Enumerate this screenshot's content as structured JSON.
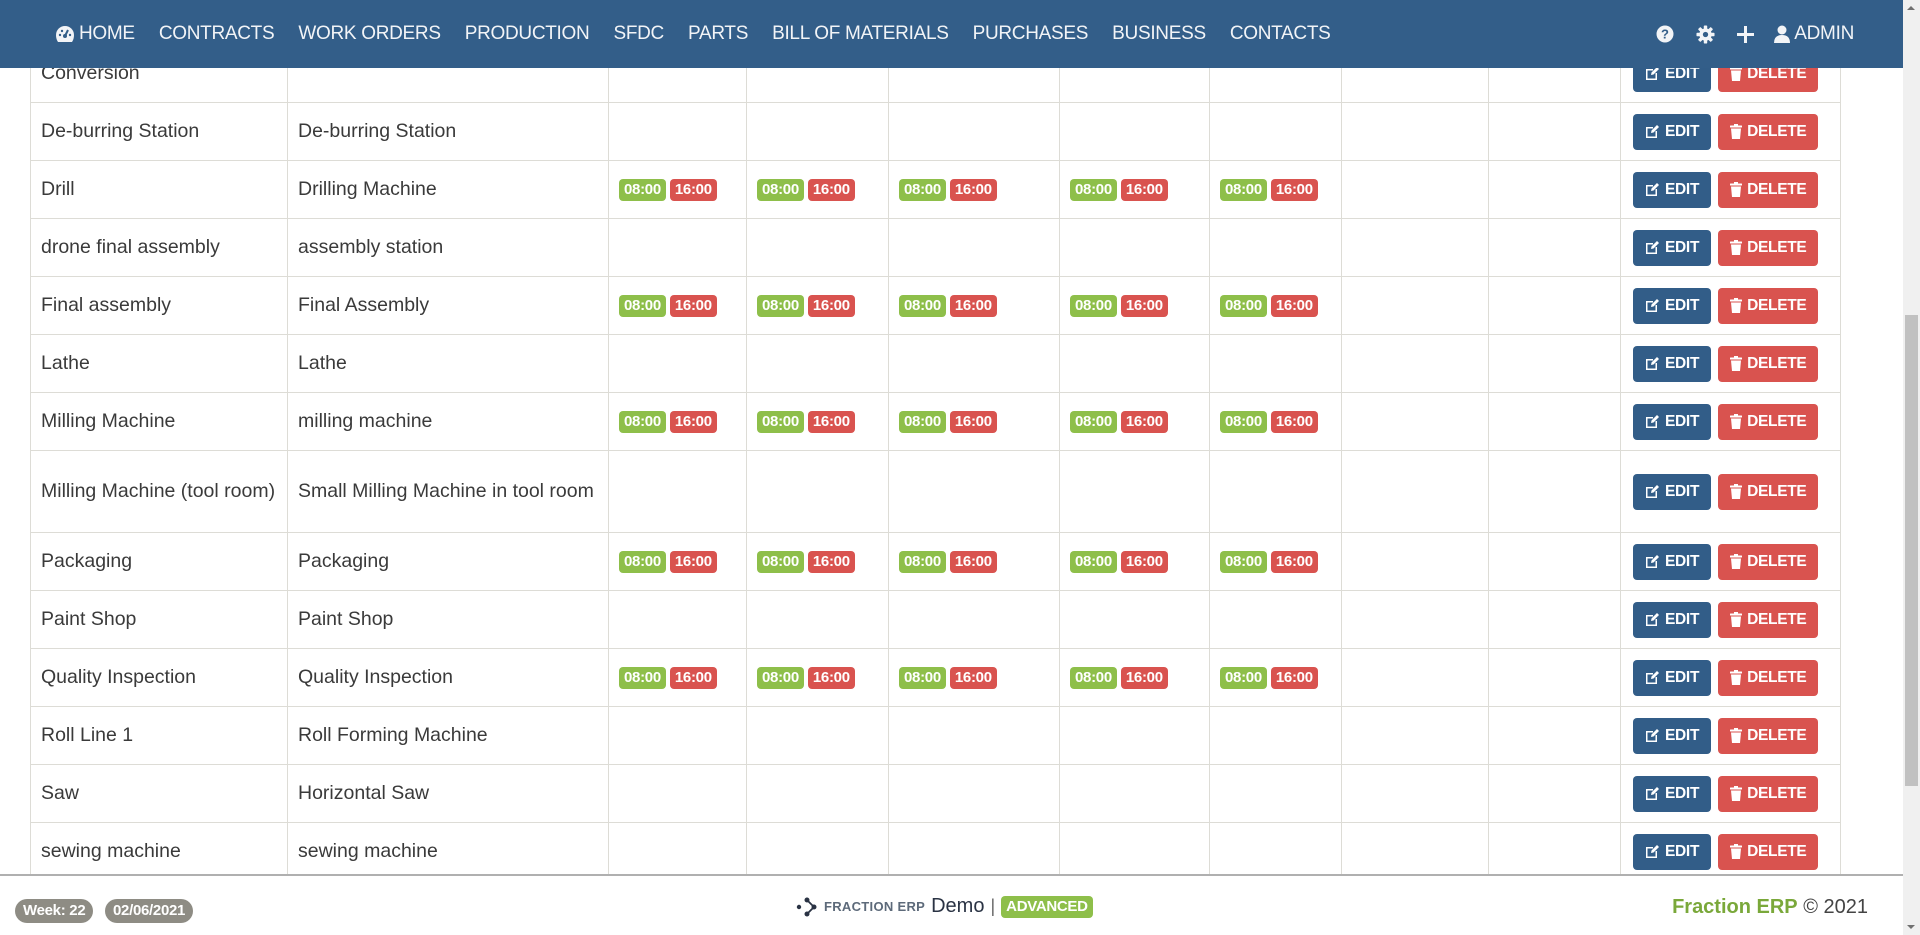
{
  "nav": {
    "items": [
      {
        "label": "HOME",
        "icon": "dashboard-icon"
      },
      {
        "label": "CONTRACTS"
      },
      {
        "label": "WORK ORDERS"
      },
      {
        "label": "PRODUCTION"
      },
      {
        "label": "SFDC"
      },
      {
        "label": "PARTS"
      },
      {
        "label": "BILL OF MATERIALS"
      },
      {
        "label": "PURCHASES"
      },
      {
        "label": "BUSINESS"
      },
      {
        "label": "CONTACTS"
      }
    ],
    "right": {
      "help_icon": "question-circle-icon",
      "settings_icon": "gear-icon",
      "add_icon": "plus-icon",
      "user_label": "ADMIN",
      "user_icon": "user-icon"
    }
  },
  "table": {
    "edit_label": "EDIT",
    "delete_label": "DELETE",
    "rows": [
      {
        "name": "Conversion",
        "description": "",
        "schedule": [
          null,
          null,
          null,
          null,
          null,
          null,
          null
        ]
      },
      {
        "name": "De-burring Station",
        "description": "De-burring Station",
        "schedule": [
          null,
          null,
          null,
          null,
          null,
          null,
          null
        ]
      },
      {
        "name": "Drill",
        "description": "Drilling Machine",
        "schedule": [
          [
            "08:00",
            "16:00"
          ],
          [
            "08:00",
            "16:00"
          ],
          [
            "08:00",
            "16:00"
          ],
          [
            "08:00",
            "16:00"
          ],
          [
            "08:00",
            "16:00"
          ],
          null,
          null
        ]
      },
      {
        "name": "drone final assembly",
        "description": "assembly station",
        "schedule": [
          null,
          null,
          null,
          null,
          null,
          null,
          null
        ]
      },
      {
        "name": "Final assembly",
        "description": "Final Assembly",
        "schedule": [
          [
            "08:00",
            "16:00"
          ],
          [
            "08:00",
            "16:00"
          ],
          [
            "08:00",
            "16:00"
          ],
          [
            "08:00",
            "16:00"
          ],
          [
            "08:00",
            "16:00"
          ],
          null,
          null
        ]
      },
      {
        "name": "Lathe",
        "description": "Lathe",
        "schedule": [
          null,
          null,
          null,
          null,
          null,
          null,
          null
        ]
      },
      {
        "name": "Milling Machine",
        "description": "milling machine",
        "schedule": [
          [
            "08:00",
            "16:00"
          ],
          [
            "08:00",
            "16:00"
          ],
          [
            "08:00",
            "16:00"
          ],
          [
            "08:00",
            "16:00"
          ],
          [
            "08:00",
            "16:00"
          ],
          null,
          null
        ]
      },
      {
        "name": "Milling Machine (tool room)",
        "description": "Small Milling Machine in tool room",
        "schedule": [
          null,
          null,
          null,
          null,
          null,
          null,
          null
        ]
      },
      {
        "name": "Packaging",
        "description": "Packaging",
        "schedule": [
          [
            "08:00",
            "16:00"
          ],
          [
            "08:00",
            "16:00"
          ],
          [
            "08:00",
            "16:00"
          ],
          [
            "08:00",
            "16:00"
          ],
          [
            "08:00",
            "16:00"
          ],
          null,
          null
        ]
      },
      {
        "name": "Paint Shop",
        "description": "Paint Shop",
        "schedule": [
          null,
          null,
          null,
          null,
          null,
          null,
          null
        ]
      },
      {
        "name": "Quality Inspection",
        "description": "Quality Inspection",
        "schedule": [
          [
            "08:00",
            "16:00"
          ],
          [
            "08:00",
            "16:00"
          ],
          [
            "08:00",
            "16:00"
          ],
          [
            "08:00",
            "16:00"
          ],
          [
            "08:00",
            "16:00"
          ],
          null,
          null
        ]
      },
      {
        "name": "Roll Line 1",
        "description": "Roll Forming Machine",
        "schedule": [
          null,
          null,
          null,
          null,
          null,
          null,
          null
        ]
      },
      {
        "name": "Saw",
        "description": "Horizontal Saw",
        "schedule": [
          null,
          null,
          null,
          null,
          null,
          null,
          null
        ]
      },
      {
        "name": "sewing machine",
        "description": "sewing machine",
        "schedule": [
          null,
          null,
          null,
          null,
          null,
          null,
          null
        ]
      }
    ]
  },
  "footer": {
    "week_label": "Week: 22",
    "date_label": "02/06/2021",
    "brand_name": "FRACTION ERP",
    "brand_demo": "Demo",
    "separator": "|",
    "edition": "ADVANCED",
    "copyright_brand": "Fraction ERP",
    "copyright_text": "© 2021"
  },
  "colors": {
    "navbar": "#335e89",
    "start_badge": "#8ebf4a",
    "end_badge": "#d9534f",
    "edit_button": "#325d88",
    "delete_button": "#d9534f",
    "footer_pill": "#8e8c84",
    "brand_green": "#7aa83a"
  }
}
